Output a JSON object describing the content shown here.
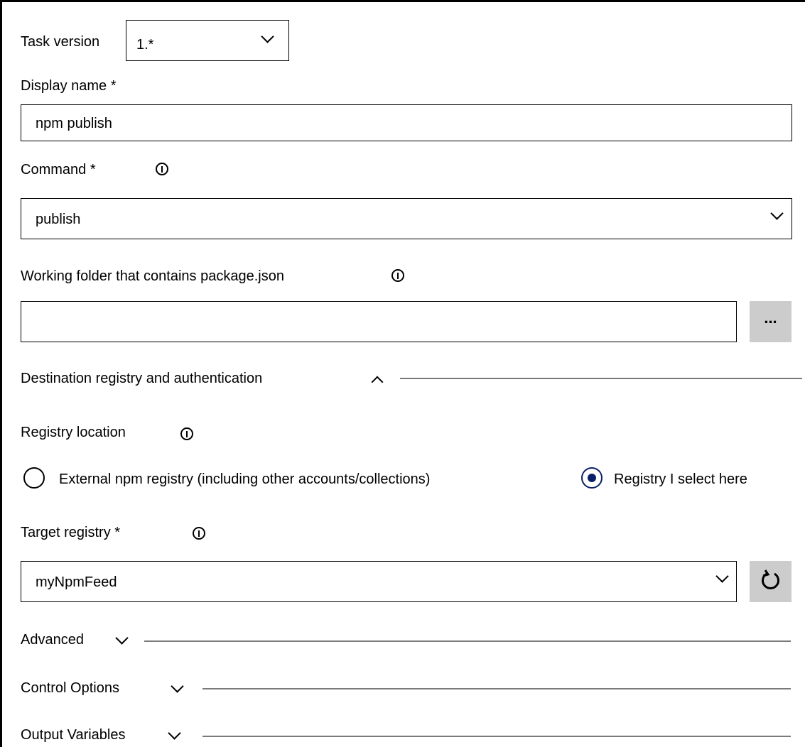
{
  "task_version": {
    "label": "Task version",
    "value": "1.*"
  },
  "display_name": {
    "label": "Display name *",
    "value": "npm publish"
  },
  "command": {
    "label": "Command *",
    "value": "publish"
  },
  "working_folder": {
    "label": "Working folder that contains package.json",
    "value": "",
    "browse_label": "..."
  },
  "destination_section": {
    "label": "Destination registry and authentication",
    "expanded": true
  },
  "registry_location": {
    "label": "Registry location",
    "options": [
      {
        "label": "External npm registry (including other accounts/collections)",
        "selected": false
      },
      {
        "label": "Registry I select here",
        "selected": true
      }
    ]
  },
  "target_registry": {
    "label": "Target registry *",
    "value": "myNpmFeed"
  },
  "sections": [
    {
      "label": "Advanced",
      "expanded": false
    },
    {
      "label": "Control Options",
      "expanded": false
    },
    {
      "label": "Output Variables",
      "expanded": false
    }
  ],
  "colors": {
    "button_grey": "#cccccc",
    "radio_selected": "#0b1f66",
    "rule": "#7a7a7a"
  }
}
